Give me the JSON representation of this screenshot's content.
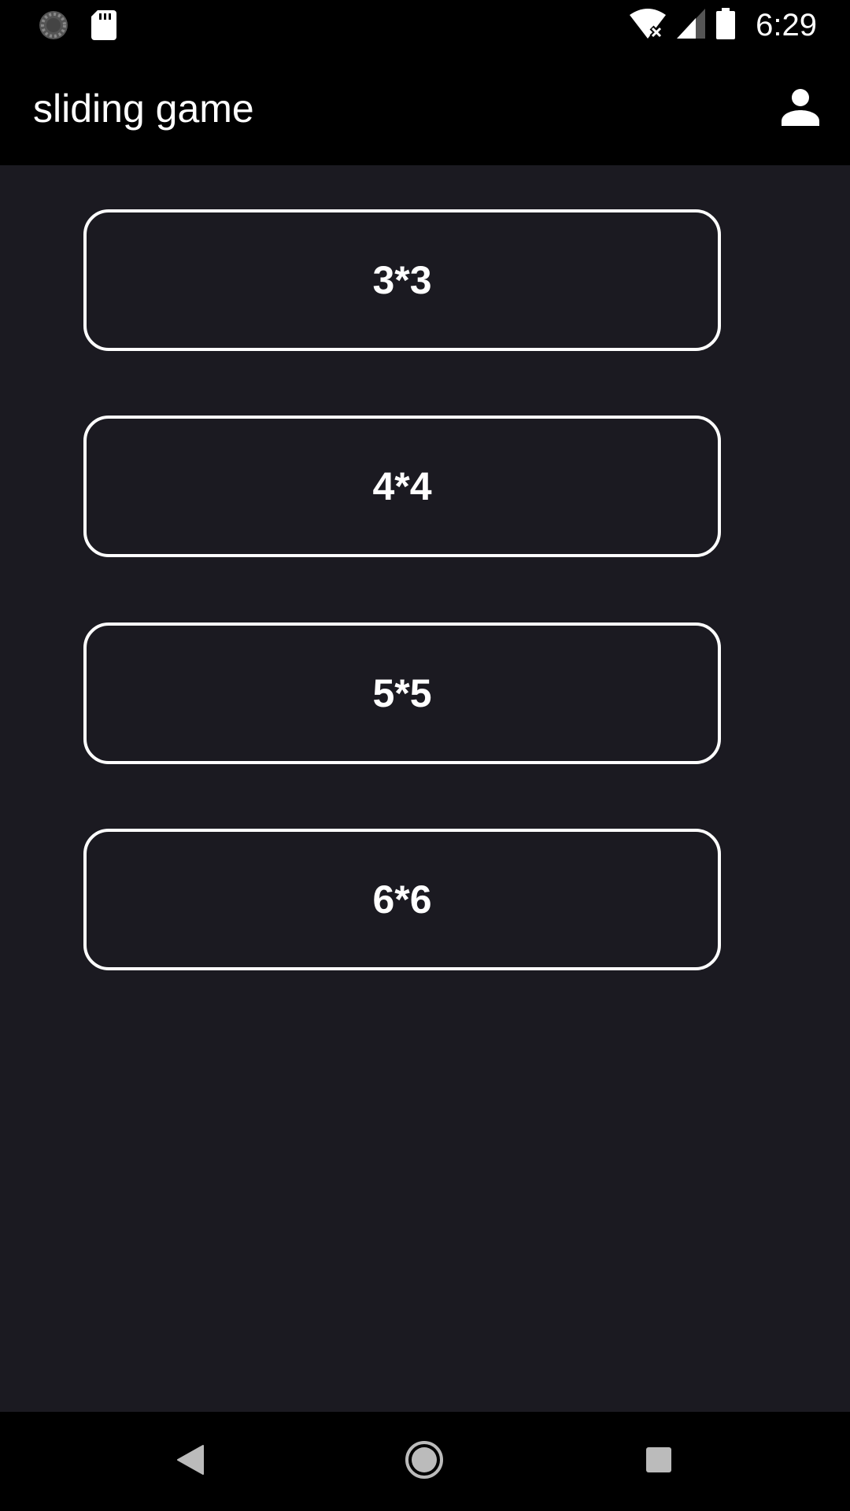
{
  "status_bar": {
    "time": "6:29",
    "left_icons": [
      "loading-icon",
      "sd-card-icon"
    ],
    "right_icons": [
      "wifi-off-icon",
      "cell-signal-icon",
      "battery-icon"
    ]
  },
  "app_bar": {
    "title": "sliding game",
    "account_icon": "person-icon"
  },
  "grid_options": [
    "3*3",
    "4*4",
    "5*5",
    "6*6"
  ],
  "nav_bar": {
    "buttons": [
      "back-icon",
      "home-icon",
      "recents-icon"
    ]
  },
  "colors": {
    "background": "#1b1a21",
    "bars": "#000000",
    "foreground": "#ffffff"
  }
}
